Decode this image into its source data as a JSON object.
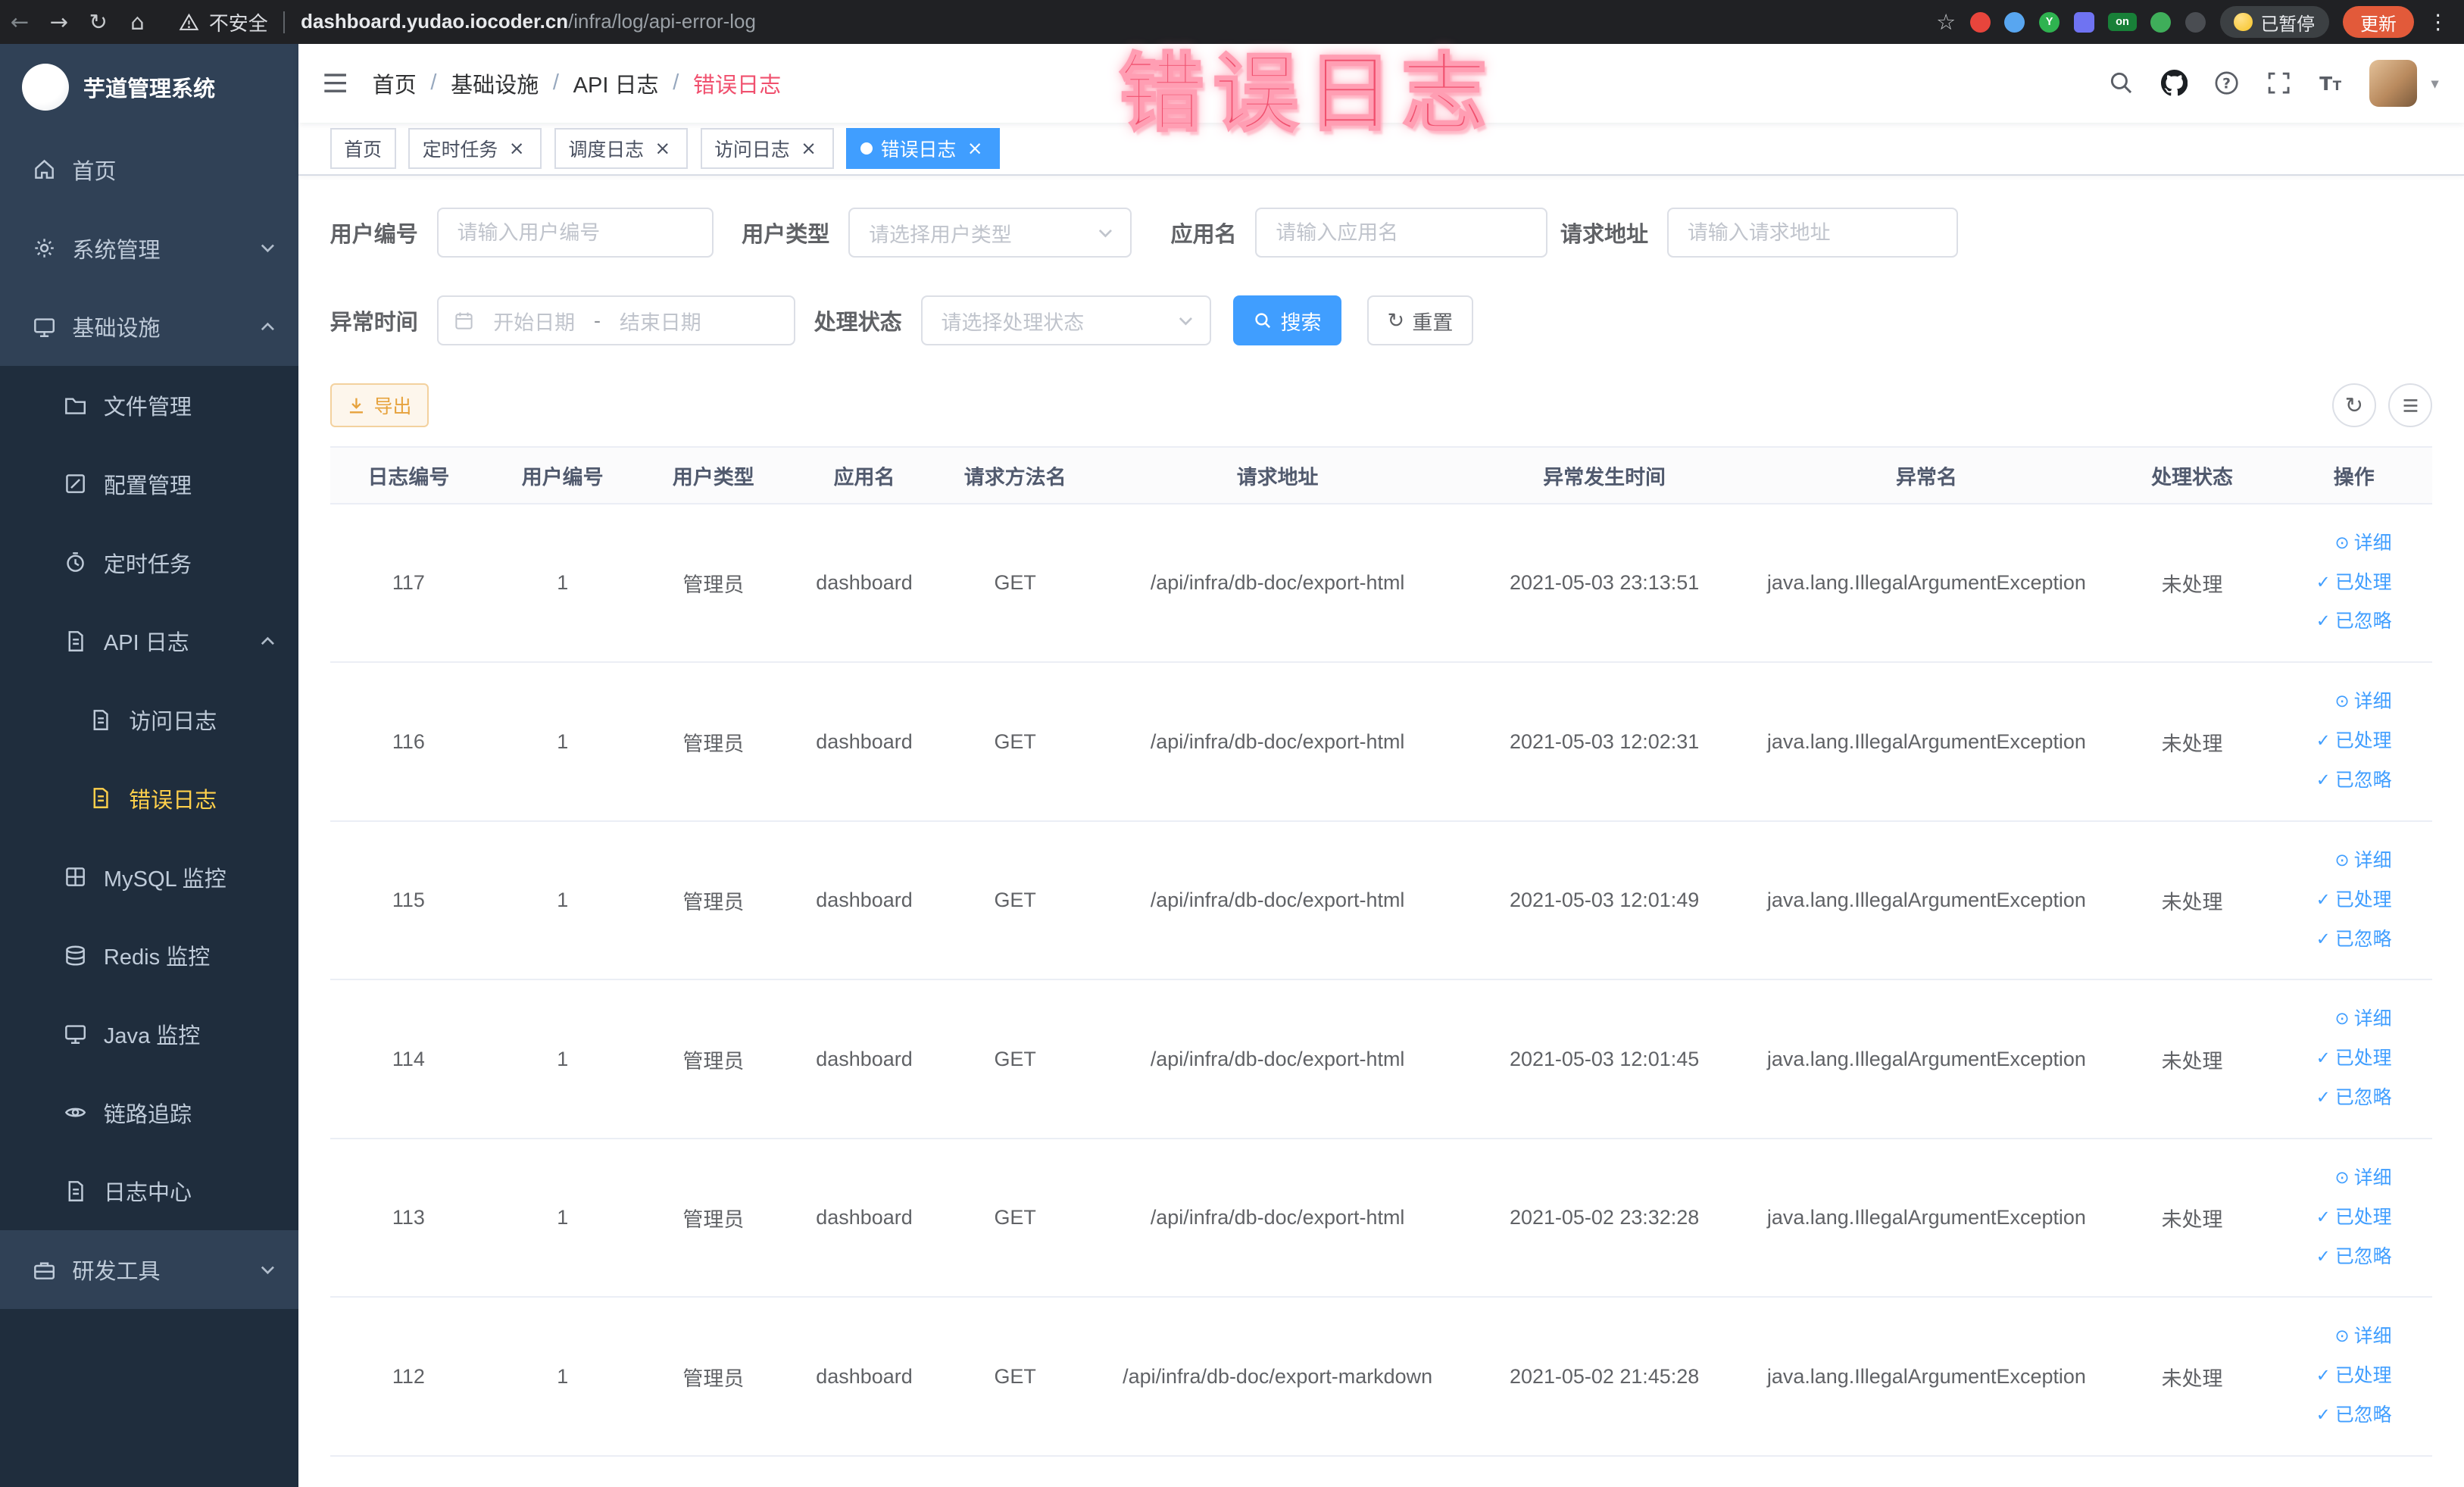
{
  "colors": {
    "primary": "#409eff",
    "link": "#409eff",
    "sidebar_bg": "#304156",
    "sidebar_sub_bg": "#1f2d3d",
    "sidebar_text": "#bfcbd9",
    "sidebar_active": "#ffd04b",
    "warning_text": "#e6a23c",
    "warning_bg": "#fdf6ec",
    "warning_border": "#f3d19e",
    "annotation": "#f0506e",
    "update_button": "#e25a3a"
  },
  "browser": {
    "security_label": "不安全",
    "url_host": "dashboard.yudao.iocoder.cn",
    "url_path": "/infra/log/api-error-log",
    "paused_badge": "已暂停",
    "update_button": "更新",
    "extensions": [
      {
        "name": "extension-icon-red",
        "color": "#e8453c",
        "shape": "circle",
        "letter": ""
      },
      {
        "name": "extension-icon-blue",
        "color": "#58a6f0",
        "shape": "circle",
        "letter": ""
      },
      {
        "name": "extension-icon-green-y",
        "color": "#2fb350",
        "shape": "circle",
        "letter": "Y"
      },
      {
        "name": "extension-icon-indigo",
        "color": "#6f73f2",
        "shape": "square",
        "letter": ""
      },
      {
        "name": "extension-icon-on-badge",
        "color": "#188038",
        "shape": "badge",
        "letter": "on"
      },
      {
        "name": "extension-icon-leaf",
        "color": "#3fae5a",
        "shape": "circle",
        "letter": ""
      },
      {
        "name": "extension-icon-paw",
        "color": "#4a4d52",
        "shape": "circle",
        "letter": ""
      }
    ]
  },
  "overlay": {
    "annotation": "错误日志"
  },
  "sidebar": {
    "logo_title": "芋道管理系统",
    "items": [
      {
        "key": "home",
        "label": "首页",
        "icon": "home-icon",
        "level": 1,
        "arrow": "",
        "active": false
      },
      {
        "key": "system",
        "label": "系统管理",
        "icon": "gear-icon",
        "level": 1,
        "arrow": "down",
        "active": false
      },
      {
        "key": "infra",
        "label": "基础设施",
        "icon": "monitor-icon",
        "level": 1,
        "arrow": "up",
        "active": false
      },
      {
        "key": "file",
        "label": "文件管理",
        "icon": "folder-icon",
        "level": 2,
        "arrow": "",
        "active": false
      },
      {
        "key": "config",
        "label": "配置管理",
        "icon": "edit-icon",
        "level": 2,
        "arrow": "",
        "active": false
      },
      {
        "key": "job",
        "label": "定时任务",
        "icon": "timer-icon",
        "level": 2,
        "arrow": "",
        "active": false
      },
      {
        "key": "api-log",
        "label": "API 日志",
        "icon": "doc-icon",
        "level": 2,
        "arrow": "up",
        "active": false
      },
      {
        "key": "access-log",
        "label": "访问日志",
        "icon": "doc-icon",
        "level": 3,
        "arrow": "",
        "active": false
      },
      {
        "key": "error-log",
        "label": "错误日志",
        "icon": "doc-icon",
        "level": 3,
        "arrow": "",
        "active": true
      },
      {
        "key": "mysql",
        "label": "MySQL 监控",
        "icon": "grid-icon",
        "level": 2,
        "arrow": "",
        "active": false
      },
      {
        "key": "redis",
        "label": "Redis 监控",
        "icon": "db-icon",
        "level": 2,
        "arrow": "",
        "active": false
      },
      {
        "key": "java",
        "label": "Java 监控",
        "icon": "monitor-icon",
        "level": 2,
        "arrow": "",
        "active": false
      },
      {
        "key": "tracer",
        "label": "链路追踪",
        "icon": "eye-icon",
        "level": 2,
        "arrow": "",
        "active": false
      },
      {
        "key": "log-center",
        "label": "日志中心",
        "icon": "doc-icon",
        "level": 2,
        "arrow": "",
        "active": false
      },
      {
        "key": "dev-tools",
        "label": "研发工具",
        "icon": "toolbox-icon",
        "level": 1,
        "arrow": "down",
        "active": false
      }
    ]
  },
  "breadcrumb": {
    "items": [
      "首页",
      "基础设施",
      "API 日志",
      "错误日志"
    ],
    "separator": "/"
  },
  "tabs": [
    {
      "key": "home",
      "label": "首页",
      "closable": false,
      "active": false
    },
    {
      "key": "job",
      "label": "定时任务",
      "closable": true,
      "active": false
    },
    {
      "key": "job-log",
      "label": "调度日志",
      "closable": true,
      "active": false
    },
    {
      "key": "access-log",
      "label": "访问日志",
      "closable": true,
      "active": false
    },
    {
      "key": "error-log",
      "label": "错误日志",
      "closable": true,
      "active": true
    }
  ],
  "filters": {
    "user_id": {
      "label": "用户编号",
      "placeholder": "请输入用户编号"
    },
    "user_type": {
      "label": "用户类型",
      "placeholder": "请选择用户类型"
    },
    "app_name": {
      "label": "应用名",
      "placeholder": "请输入应用名"
    },
    "request_url": {
      "label": "请求地址",
      "placeholder": "请输入请求地址"
    },
    "exception_time": {
      "label": "异常时间",
      "start_placeholder": "开始日期",
      "separator": "-",
      "end_placeholder": "结束日期"
    },
    "process_status": {
      "label": "处理状态",
      "placeholder": "请选择处理状态"
    },
    "search_label": "搜索",
    "reset_label": "重置"
  },
  "toolbar": {
    "export_label": "导出"
  },
  "table": {
    "columns": [
      "日志编号",
      "用户编号",
      "用户类型",
      "应用名",
      "请求方法名",
      "请求地址",
      "异常发生时间",
      "异常名",
      "处理状态",
      "操作"
    ],
    "row_actions": [
      {
        "key": "detail",
        "label": "详细",
        "icon": "detail-eye-icon"
      },
      {
        "key": "processed",
        "label": "已处理",
        "icon": "check-icon"
      },
      {
        "key": "ignored",
        "label": "已忽略",
        "icon": "check-icon"
      }
    ],
    "rows": [
      {
        "id": "117",
        "user_id": "1",
        "user_type": "管理员",
        "app_name": "dashboard",
        "method": "GET",
        "url": "/api/infra/db-doc/export-html",
        "time": "2021-05-03 23:13:51",
        "exception": "java.lang.IllegalArgumentException",
        "status": "未处理"
      },
      {
        "id": "116",
        "user_id": "1",
        "user_type": "管理员",
        "app_name": "dashboard",
        "method": "GET",
        "url": "/api/infra/db-doc/export-html",
        "time": "2021-05-03 12:02:31",
        "exception": "java.lang.IllegalArgumentException",
        "status": "未处理"
      },
      {
        "id": "115",
        "user_id": "1",
        "user_type": "管理员",
        "app_name": "dashboard",
        "method": "GET",
        "url": "/api/infra/db-doc/export-html",
        "time": "2021-05-03 12:01:49",
        "exception": "java.lang.IllegalArgumentException",
        "status": "未处理"
      },
      {
        "id": "114",
        "user_id": "1",
        "user_type": "管理员",
        "app_name": "dashboard",
        "method": "GET",
        "url": "/api/infra/db-doc/export-html",
        "time": "2021-05-03 12:01:45",
        "exception": "java.lang.IllegalArgumentException",
        "status": "未处理"
      },
      {
        "id": "113",
        "user_id": "1",
        "user_type": "管理员",
        "app_name": "dashboard",
        "method": "GET",
        "url": "/api/infra/db-doc/export-html",
        "time": "2021-05-02 23:32:28",
        "exception": "java.lang.IllegalArgumentException",
        "status": "未处理"
      },
      {
        "id": "112",
        "user_id": "1",
        "user_type": "管理员",
        "app_name": "dashboard",
        "method": "GET",
        "url": "/api/infra/db-doc/export-markdown",
        "time": "2021-05-02 21:45:28",
        "exception": "java.lang.IllegalArgumentException",
        "status": "未处理"
      }
    ]
  }
}
